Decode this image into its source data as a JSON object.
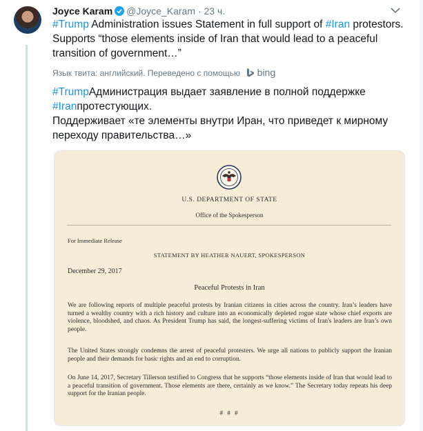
{
  "tweet": {
    "display_name": "Joyce Karam",
    "handle": "@Joyce_Karam",
    "separator": "·",
    "time": "23 ч.",
    "text_parts": [
      {
        "text": "#Trump",
        "tag": true
      },
      {
        "text": " Administration issues Statement in full support of ",
        "tag": false
      },
      {
        "text": "#Iran",
        "tag": true
      },
      {
        "text": " protestors. Supports “those elements inside of Iran that would lead to a peaceful transition of government…”",
        "tag": false
      }
    ],
    "translation_note": "Язык твита: английский. Переведено с помощью",
    "translation_service": "bing",
    "translated_parts": [
      {
        "text": "#Trump",
        "tag": true
      },
      {
        "text": "Администрация выдает заявление в полной поддержке ",
        "tag": false
      },
      {
        "text": "#Iran",
        "tag": true
      },
      {
        "text": "протестующих.",
        "tag": false
      },
      {
        "text": "\nПоддерживает «те элементы внутри Иран, что приведет к мирному переходу правительства…»",
        "tag": false
      }
    ]
  },
  "document": {
    "department": "U.S. DEPARTMENT OF STATE",
    "office": "Office of the Spokesperson",
    "release": "For Immediate Release",
    "statement_by": "STATEMENT BY HEATHER NAUERT, SPOKESPERSON",
    "date": "December 29, 2017",
    "title": "Peaceful Protests in Iran",
    "paragraphs": [
      "We are following reports of multiple peaceful protests by Iranian citizens in cities across the country. Iran’s leaders have turned a wealthy country with a rich history and culture into an economically depleted rogue state whose chief exports are violence, bloodshed, and chaos. As President Trump has said, the longest-suffering victims of Iran's leaders are Iran’s own people.",
      "The United States strongly condemns the arrest of peaceful protesters. We urge all nations to publicly support the Iranian people and their demands for basic rights and an end to corruption.",
      "On June 14, 2017, Secretary Tillerson testified to Congress that he supports “those elements inside of Iran that would lead to a peaceful transition of government. Those elements are there, certainly as we know.” The Secretary today repeats his deep support for the Iranian people."
    ],
    "end_mark": "# # #"
  },
  "colors": {
    "hashtag": "#1b95e0",
    "verified": "#1da1f2",
    "thread_line": "#c4e3f3",
    "paper": "#f6ecd8"
  },
  "icons": [
    "verified-badge-icon",
    "chevron-down-icon",
    "bing-logo-icon",
    "state-department-seal-icon"
  ]
}
